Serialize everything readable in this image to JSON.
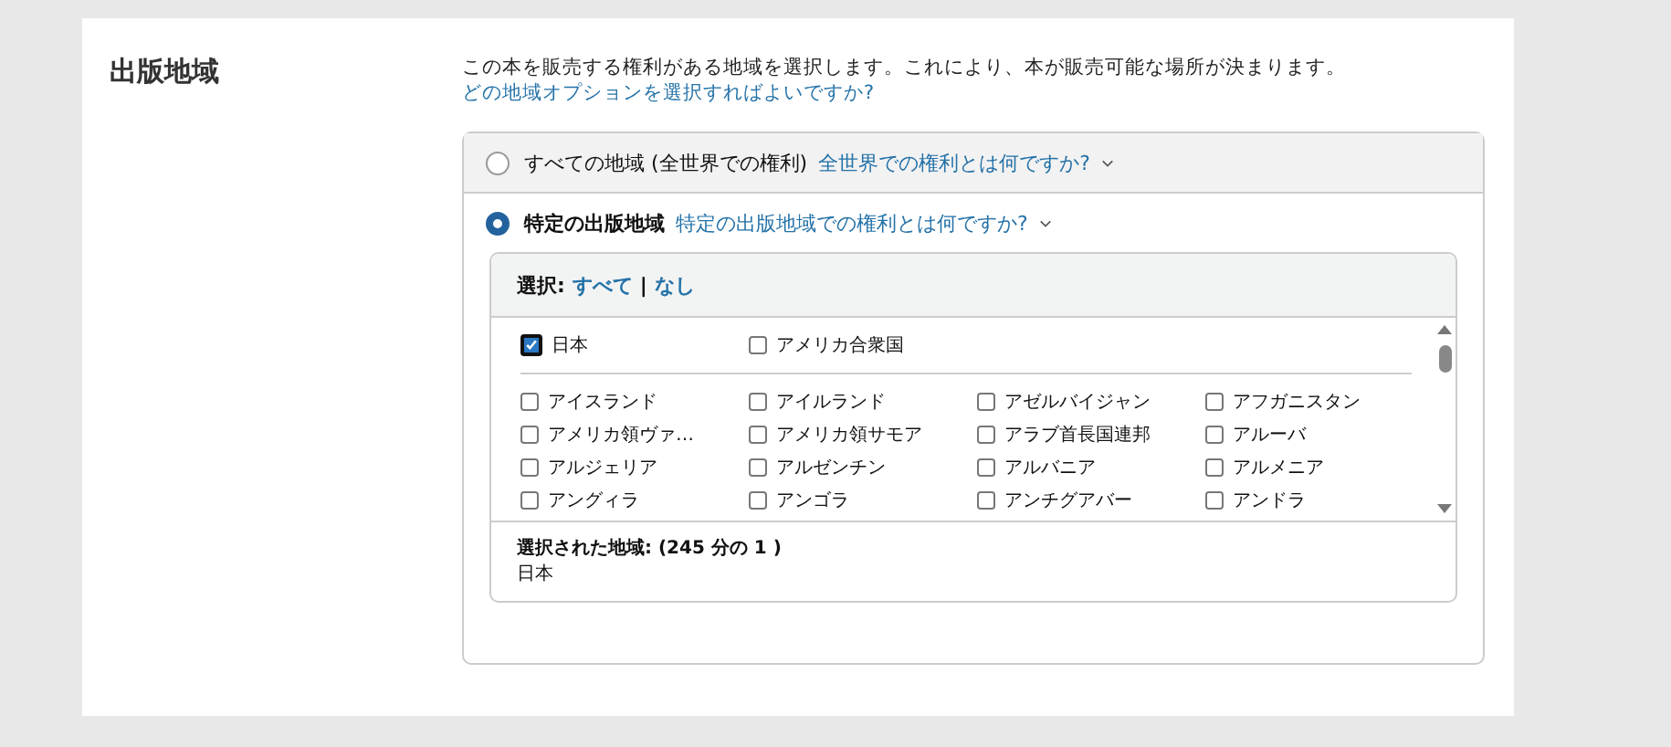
{
  "section": {
    "title": "出版地域",
    "description": "この本を販売する権利がある地域を選択します。これにより、本が販売可能な場所が決まります。",
    "help_link": "どの地域オプションを選択すればよいですか?"
  },
  "options": [
    {
      "label": "すべての地域 (全世界での権利)",
      "link": "全世界での権利とは何ですか?",
      "selected": false
    },
    {
      "label": "特定の出版地域",
      "link": "特定の出版地域での権利とは何ですか?",
      "selected": true
    }
  ],
  "selector": {
    "label": "選択:",
    "all": "すべて",
    "separator": "|",
    "none": "なし"
  },
  "featured": [
    {
      "label": "日本",
      "checked": true
    },
    {
      "label": "アメリカ合衆国",
      "checked": false
    }
  ],
  "countries": [
    {
      "label": "アイスランド",
      "checked": false
    },
    {
      "label": "アイルランド",
      "checked": false
    },
    {
      "label": "アゼルバイジャン",
      "checked": false
    },
    {
      "label": "アフガニスタン",
      "checked": false
    },
    {
      "label": "アメリカ領ヴァ…",
      "checked": false
    },
    {
      "label": "アメリカ領サモア",
      "checked": false
    },
    {
      "label": "アラブ首長国連邦",
      "checked": false
    },
    {
      "label": "アルーバ",
      "checked": false
    },
    {
      "label": "アルジェリア",
      "checked": false
    },
    {
      "label": "アルゼンチン",
      "checked": false
    },
    {
      "label": "アルバニア",
      "checked": false
    },
    {
      "label": "アルメニア",
      "checked": false
    },
    {
      "label": "アングィラ",
      "checked": false
    },
    {
      "label": "アンゴラ",
      "checked": false
    },
    {
      "label": "アンチグアバー",
      "checked": false
    },
    {
      "label": "アンドラ",
      "checked": false
    }
  ],
  "summary": {
    "label": "選択された地域: (245 分の 1 )",
    "value": "日本"
  }
}
